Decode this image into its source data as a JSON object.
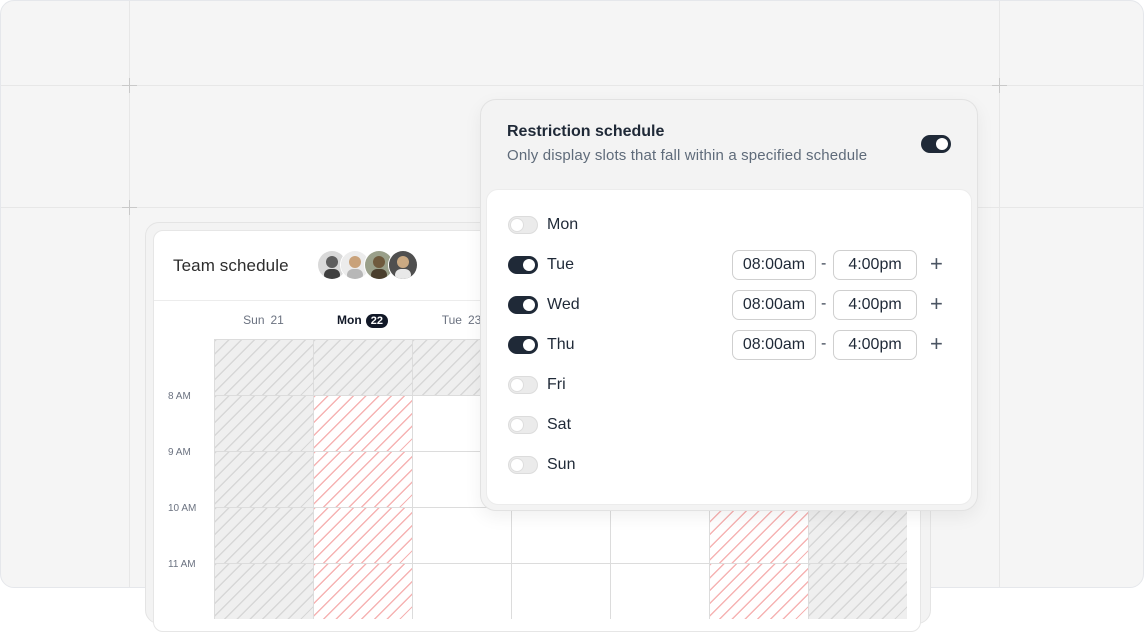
{
  "team": {
    "title": "Team schedule",
    "avatars": [
      {
        "name": "avatar-1",
        "color": "#6b6b6b"
      },
      {
        "name": "avatar-2",
        "color": "#c9a27a"
      },
      {
        "name": "avatar-3",
        "color": "#6f5a3d"
      },
      {
        "name": "avatar-4",
        "color": "#9a7d5a"
      }
    ],
    "days": [
      {
        "label": "Sun",
        "num": "21",
        "active": false
      },
      {
        "label": "Mon",
        "num": "22",
        "active": true
      },
      {
        "label": "Tue",
        "num": "23",
        "active": false
      }
    ],
    "times": [
      "8 AM",
      "9 AM",
      "10 AM",
      "11 AM"
    ]
  },
  "restriction": {
    "title": "Restriction schedule",
    "subtitle": "Only display slots that fall within a specified schedule",
    "enabled": true,
    "days": [
      {
        "day": "Mon",
        "enabled": false
      },
      {
        "day": "Tue",
        "enabled": true,
        "start": "08:00am",
        "end": "4:00pm"
      },
      {
        "day": "Wed",
        "enabled": true,
        "start": "08:00am",
        "end": "4:00pm"
      },
      {
        "day": "Thu",
        "enabled": true,
        "start": "08:00am",
        "end": "4:00pm"
      },
      {
        "day": "Fri",
        "enabled": false
      },
      {
        "day": "Sat",
        "enabled": false
      },
      {
        "day": "Sun",
        "enabled": false
      }
    ],
    "separator": "-",
    "add_symbol": "+"
  },
  "colors": {
    "accent": "#1f2937",
    "blocked_pink": "#f6b3b3",
    "blocked_gray": "#d7d7d7"
  }
}
